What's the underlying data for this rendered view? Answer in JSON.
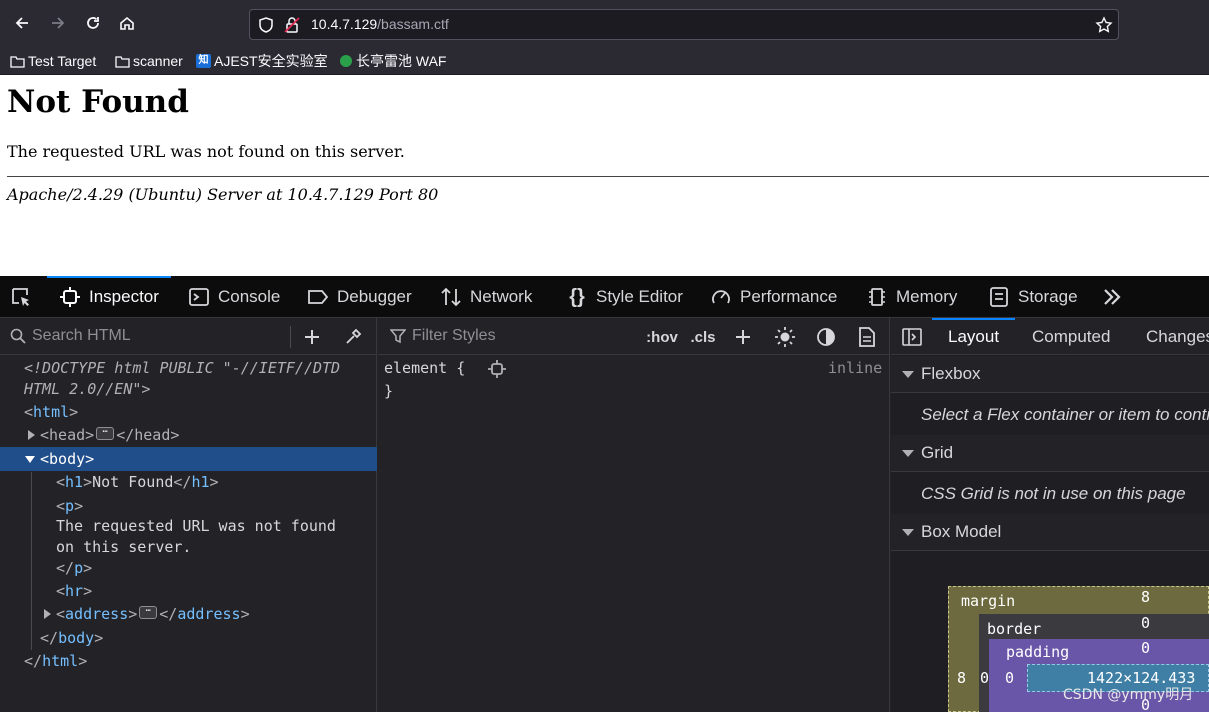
{
  "browser": {
    "url_host": "10.4.7.129",
    "url_path": "/bassam.ctf",
    "bookmarks": [
      {
        "label": "Test Target",
        "icon": "folder-icon"
      },
      {
        "label": "scanner",
        "icon": "folder-icon"
      },
      {
        "label": "AJEST安全实验室",
        "icon": "zhihu-icon"
      },
      {
        "label": "长亭雷池 WAF",
        "icon": "leaf-icon"
      }
    ],
    "zhi_glyph": "知"
  },
  "page": {
    "heading": "Not Found",
    "message": "The requested URL was not found on this server.",
    "address": "Apache/2.4.29 (Ubuntu) Server at 10.4.7.129 Port 80"
  },
  "devtools": {
    "tabs": [
      "Inspector",
      "Console",
      "Debugger",
      "Network",
      "Style Editor",
      "Performance",
      "Memory",
      "Storage"
    ],
    "active_tab": "Inspector",
    "markup": {
      "search_placeholder": "Search HTML",
      "doctype_line1": "<!DOCTYPE html PUBLIC \"-//IETF//DTD",
      "doctype_line2": "HTML 2.0//EN\">",
      "html_tag": "html",
      "head_tag": "head",
      "body_tag": "body",
      "h1_tag": "h1",
      "h1_text": "Not Found",
      "p_tag": "p",
      "p_text_line1": "The requested URL was not found",
      "p_text_line2": "on this server.",
      "hr_tag": "hr",
      "address_tag": "address",
      "ellipsis": "⋯"
    },
    "rules": {
      "filter_placeholder": "Filter Styles",
      "hov": ":hov",
      "cls": ".cls",
      "selector": "element {",
      "close": "}",
      "source": "inline"
    },
    "layout": {
      "tabs": [
        "Layout",
        "Computed",
        "Changes"
      ],
      "active_tab": "Layout",
      "flexbox_title": "Flexbox",
      "flexbox_msg": "Select a Flex container or item to continue.",
      "grid_title": "Grid",
      "grid_msg": "CSS Grid is not in use on this page",
      "boxmodel_title": "Box Model",
      "box": {
        "margin_label": "margin",
        "border_label": "border",
        "padding_label": "padding",
        "margin_top": "8",
        "margin_left": "8",
        "border_top": "0",
        "border_left": "0",
        "padding_top": "0",
        "padding_left": "0",
        "padding_bottom": "0",
        "content_size": "1422×124.433"
      }
    }
  },
  "watermark": "CSDN @ymmy明月",
  "colors": {
    "chrome_bg": "#2b2a33",
    "devtools_bg": "#232327",
    "accent": "#0a84ff",
    "selected_row": "#204e8a",
    "margin_box": "#6c6a3e",
    "border_box": "#3a3a3f",
    "padding_box": "#6a56a8",
    "content_box": "#3f7fa6"
  }
}
